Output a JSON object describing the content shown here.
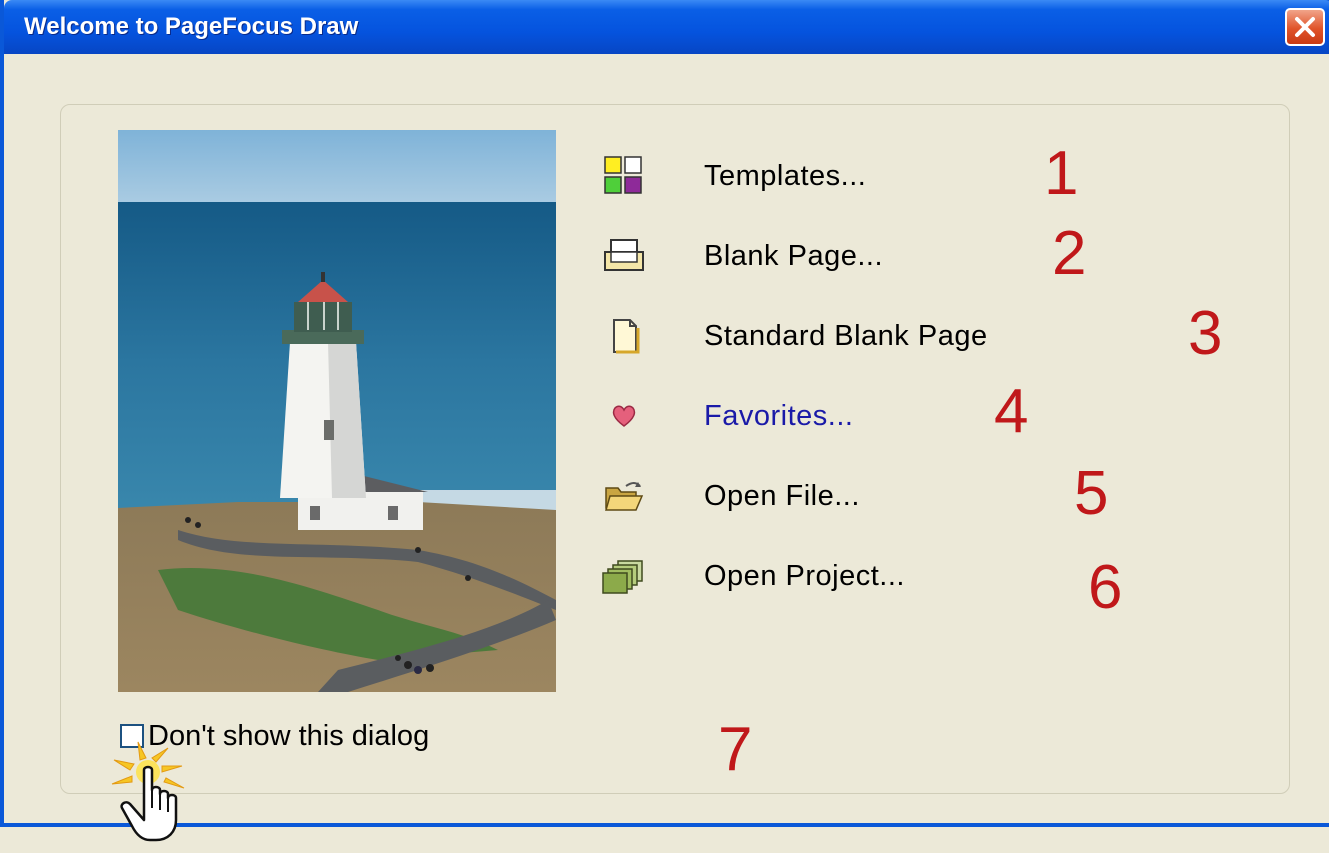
{
  "window": {
    "title": "Welcome to PageFocus Draw",
    "close_icon": "close-x-icon"
  },
  "photo": {
    "subject": "lighthouse"
  },
  "menu": [
    {
      "label": "Templates...",
      "icon": "templates-grid-icon",
      "number": "1",
      "style": "normal"
    },
    {
      "label": "Blank Page...",
      "icon": "blank-page-icon",
      "number": "2",
      "style": "normal"
    },
    {
      "label": "Standard Blank Page",
      "icon": "document-icon",
      "number": "3",
      "style": "normal"
    },
    {
      "label": "Favorites...",
      "icon": "heart-icon",
      "number": "4",
      "style": "link"
    },
    {
      "label": "Open File...",
      "icon": "open-folder-icon",
      "number": "5",
      "style": "normal"
    },
    {
      "label": "Open Project...",
      "icon": "stacked-pages-icon",
      "number": "6",
      "style": "normal"
    }
  ],
  "dont_show": {
    "label": "Don't show this dialog",
    "checked": false,
    "number": "7"
  },
  "colors": {
    "title_bar": "#0553de",
    "annotation": "#c0181a",
    "link": "#1a1aa8",
    "background": "#ece9d8"
  }
}
